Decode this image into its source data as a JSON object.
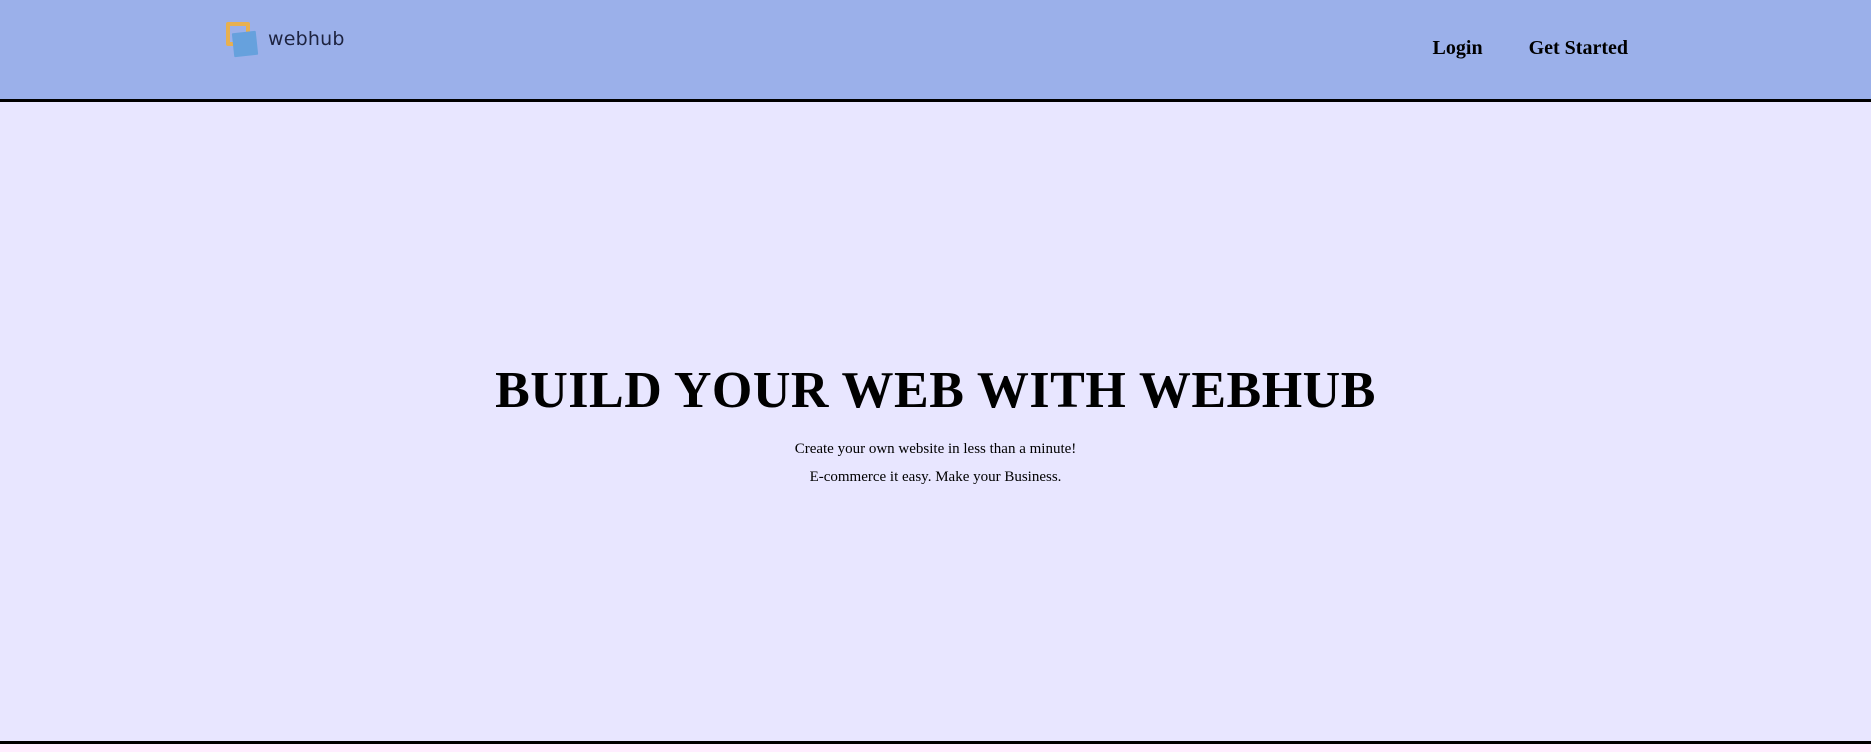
{
  "header": {
    "logo": {
      "text": "webhub",
      "icon": "webhub-logo-icon",
      "colors": {
        "frame": "#e8b04f",
        "square": "#66a1dd"
      }
    },
    "nav": {
      "login_label": "Login",
      "get_started_label": "Get Started"
    },
    "background": "#9bb0ea"
  },
  "hero": {
    "title": "BUILD YOUR WEB WITH WEBHUB",
    "subtitle_line1": "Create your own website in less than a minute!",
    "subtitle_line2": "E-commerce it easy. Make your Business.",
    "background": "#e8e6ff"
  }
}
